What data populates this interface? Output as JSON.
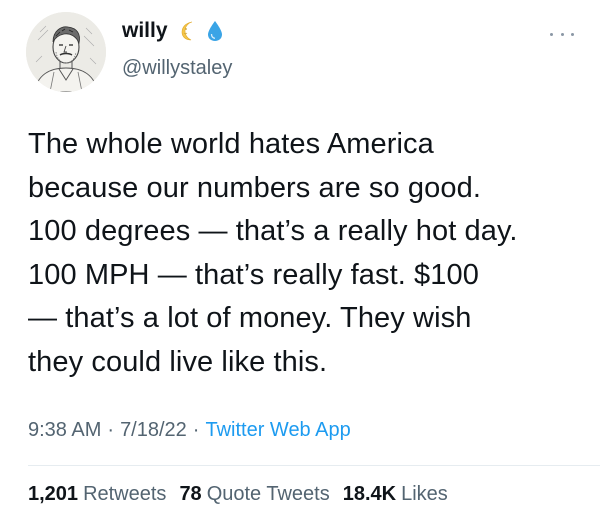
{
  "user": {
    "display_name": "willy",
    "handle": "@willystaley",
    "badges": [
      {
        "icon": "crescent-moon-icon",
        "color": "#f5c64a"
      },
      {
        "icon": "droplet-icon",
        "color": "#3aa4e6"
      }
    ]
  },
  "tweet": {
    "lines": [
      "The whole world hates America",
      "because our numbers are so good.",
      "100 degrees — that’s a really hot day.",
      "100 MPH — that’s really fast. $100",
      "— that’s a lot of money. They wish",
      "they could live like this."
    ],
    "time": "9:38 AM",
    "date": "7/18/22",
    "separator": "·",
    "source": "Twitter Web App"
  },
  "stats": {
    "retweets_count": "1,201",
    "retweets_label": "Retweets",
    "quotes_count": "78",
    "quotes_label": "Quote Tweets",
    "likes_count": "18.4K",
    "likes_label": "Likes"
  },
  "colors": {
    "text": "#0f1419",
    "secondary": "#536471",
    "link": "#1d9bf0"
  }
}
